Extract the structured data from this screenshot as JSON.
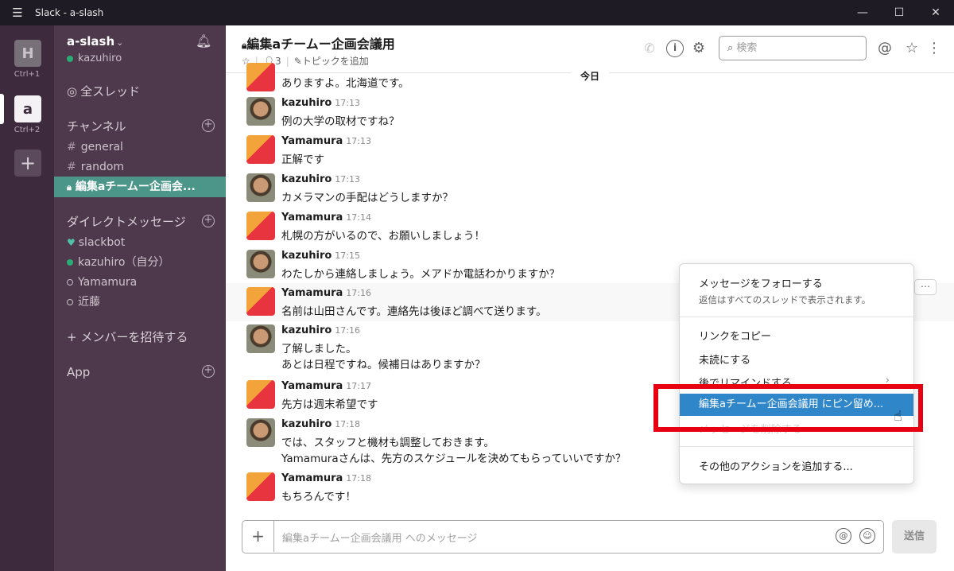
{
  "window": {
    "title": "Slack - a-slash",
    "menu_icon": "☰",
    "minimize": "—",
    "maximize": "☐",
    "close": "✕"
  },
  "rail": {
    "workspaces": [
      {
        "letter": "H",
        "shortcut": "Ctrl+1"
      },
      {
        "letter": "a",
        "shortcut": "Ctrl+2"
      }
    ],
    "add": "+"
  },
  "sidebar": {
    "team_name": "a-slash",
    "team_chevron": "⌄",
    "user": "kazuhiro",
    "all_threads": "全スレッド",
    "channels_header": "チャンネル",
    "channels": [
      "general",
      "random",
      "編集aチームー企画会..."
    ],
    "dm_header": "ダイレクトメッセージ",
    "dms": [
      "slackbot",
      "kazuhiro（自分）",
      "Yamamura",
      "近藤"
    ],
    "invite": "+ メンバーを招待する",
    "apps_header": "App"
  },
  "header": {
    "channel_title": "編集aチームー企画会議用",
    "members": "3",
    "add_topic": "トピックを追加",
    "search_placeholder": "検索"
  },
  "day_divider": "今日",
  "messages": [
    {
      "author": "",
      "time": "",
      "lines": [
        "ありますよ。北海道です。"
      ]
    },
    {
      "author": "kazuhiro",
      "time": "17:13",
      "lines": [
        "例の大学の取材ですね？"
      ]
    },
    {
      "author": "Yamamura",
      "time": "17:13",
      "lines": [
        "正解です"
      ]
    },
    {
      "author": "kazuhiro",
      "time": "17:13",
      "lines": [
        "カメラマンの手配はどうしますか？"
      ]
    },
    {
      "author": "Yamamura",
      "time": "17:14",
      "lines": [
        "札幌の方がいるので、お願いしましょう！"
      ]
    },
    {
      "author": "kazuhiro",
      "time": "17:15",
      "lines": [
        "わたしから連絡しましょう。メアドか電話わかりますか？"
      ]
    },
    {
      "author": "Yamamura",
      "time": "17:16",
      "lines": [
        "名前は山田さんです。連絡先は後ほど調べて送ります。"
      ]
    },
    {
      "author": "kazuhiro",
      "time": "17:16",
      "lines": [
        "了解しました。",
        "あとは日程ですね。候補日はありますか？"
      ]
    },
    {
      "author": "Yamamura",
      "time": "17:17",
      "lines": [
        "先方は週末希望です"
      ]
    },
    {
      "author": "kazuhiro",
      "time": "17:18",
      "lines": [
        "では、スタッフと機材も調整しておきます。",
        "Yamamuraさんは、先方のスケジュールを決めてもらっていいですか？"
      ]
    },
    {
      "author": "Yamamura",
      "time": "17:18",
      "lines": [
        "もちろんです！"
      ]
    }
  ],
  "composer": {
    "placeholder": "編集aチームー企画会議用 へのメッセージ",
    "send": "送信"
  },
  "context_menu": {
    "follow": "メッセージをフォローする",
    "follow_sub": "返信はすべてのスレッドで表示されます。",
    "copy_link": "リンクをコピー",
    "mark_unread": "未読にする",
    "remind": "後でリマインドする",
    "pin": "編集aチームー企画会議用 にピン留め...",
    "hidden_item": "メッセージを削除する",
    "more_actions": "その他のアクションを追加する..."
  }
}
